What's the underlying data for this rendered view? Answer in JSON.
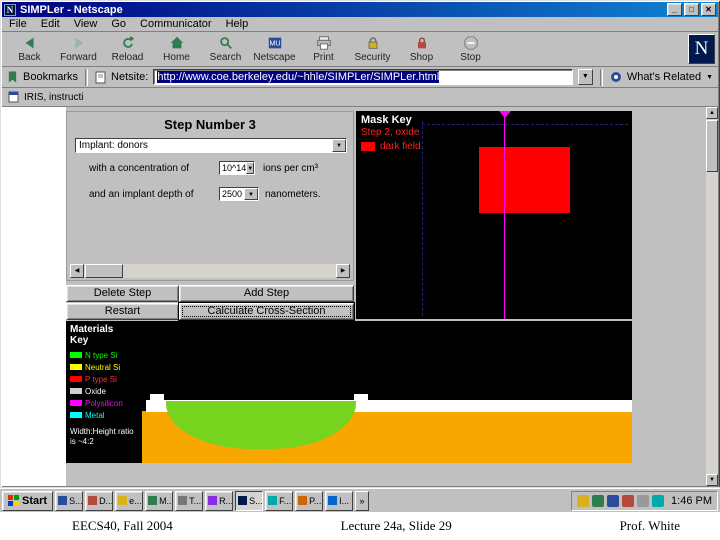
{
  "titlebar": {
    "icon_letter": "N",
    "title": "SIMPLer - Netscape",
    "minimize": "_",
    "maximize": "□",
    "close": "✕"
  },
  "menubar": {
    "items": [
      "File",
      "Edit",
      "View",
      "Go",
      "Communicator",
      "Help"
    ]
  },
  "toolbar": {
    "buttons": [
      {
        "label": "Back"
      },
      {
        "label": "Forward"
      },
      {
        "label": "Reload"
      },
      {
        "label": "Home"
      },
      {
        "label": "Search"
      },
      {
        "label": "Netscape"
      },
      {
        "label": "Print"
      },
      {
        "label": "Security"
      },
      {
        "label": "Shop"
      },
      {
        "label": "Stop"
      }
    ],
    "logo_letter": "N"
  },
  "location_bar": {
    "bookmarks_label": "Bookmarks",
    "netsite_label": "Netsite:",
    "url": "http://www.coe.berkeley.edu/~hhle/SIMPLer/SIMPLer.html",
    "whats_related_label": "What's Related"
  },
  "personal_bar": {
    "item_label": "IRIS, instructi"
  },
  "applet": {
    "step_title": "Step Number 3",
    "implant_select_value": "Implant: donors",
    "concentration_label": "with a concentration of",
    "concentration_value": "10^14",
    "concentration_unit": "ions per cm³",
    "depth_label": "and an implant depth of",
    "depth_value": "2500",
    "depth_unit": "nanometers.",
    "buttons": {
      "delete": "Delete Step",
      "add": "Add Step",
      "restart": "Restart",
      "calculate": "Calculate Cross-Section"
    }
  },
  "mask_key": {
    "title": "Mask Key",
    "step_label": "Step 2, oxide",
    "field_label": "dark field",
    "mask_color": "#ff0000",
    "cursor_color": "#ff00ff"
  },
  "materials_key": {
    "title": "Materials Key",
    "items": [
      {
        "label": "N type Si",
        "color": "#00ff00"
      },
      {
        "label": "Neutral Si",
        "color": "#ffff00"
      },
      {
        "label": "P type Si",
        "color": "#ff0000"
      },
      {
        "label": "Oxide",
        "color": "#d0d0d0"
      },
      {
        "label": "Polysilicon",
        "color": "#ff00ff"
      },
      {
        "label": "Metal",
        "color": "#00ffff"
      }
    ],
    "note": "Width:Height ratio is ~4:2"
  },
  "cross_section": {
    "substrate_color": "#f8a600",
    "oxide_color": "#ffffff",
    "implant_color": "#76d41e"
  },
  "taskbar": {
    "start_label": "Start",
    "items": [
      {
        "label": "S..."
      },
      {
        "label": "D..."
      },
      {
        "label": "e..."
      },
      {
        "label": "M..."
      },
      {
        "label": "T..."
      },
      {
        "label": "R..."
      },
      {
        "label": "S..."
      },
      {
        "label": "F..."
      },
      {
        "label": "P..."
      },
      {
        "label": "I..."
      }
    ],
    "overflow": "»",
    "clock": "1:46 PM"
  },
  "slide_footer": {
    "left": "EECS40, Fall 2004",
    "center": "Lecture 24a, Slide 29",
    "right": "Prof. White"
  }
}
